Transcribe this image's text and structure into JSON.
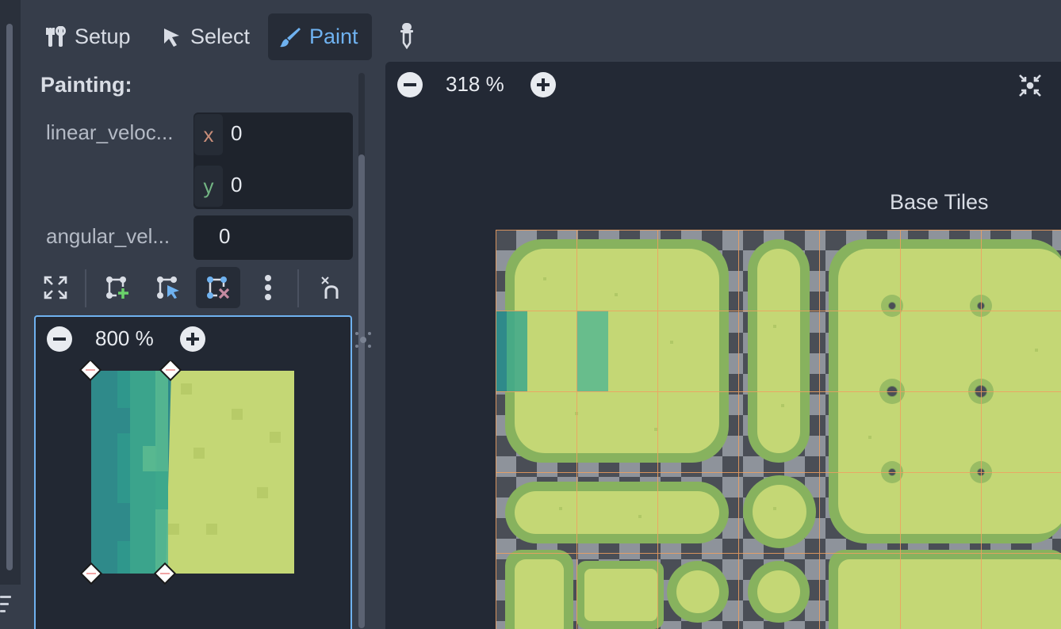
{
  "toolbar": {
    "setup_label": "Setup",
    "select_label": "Select",
    "paint_label": "Paint",
    "active_tab": "Paint",
    "picker_icon": "eyedropper-icon"
  },
  "painting": {
    "heading": "Painting:",
    "linear_velocity": {
      "label": "linear_veloc...",
      "x_tag": "x",
      "x_value": "0",
      "y_tag": "y",
      "y_value": "0"
    },
    "angular_velocity": {
      "label": "angular_vel...",
      "value": "0"
    }
  },
  "polygon_tools": {
    "icons": [
      "expand-icon",
      "add-point-icon",
      "edit-point-icon",
      "remove-point-icon",
      "more-options-icon",
      "snap-icon"
    ],
    "active": "remove-point-icon"
  },
  "tile_preview": {
    "zoom_label": "800 %"
  },
  "atlas": {
    "zoom_label": "318 %",
    "source_title": "Base Tiles"
  },
  "colors": {
    "accent": "#6fb2f0",
    "panel_bg": "#363d4a",
    "field_bg": "#1e232c",
    "grass": "#c4d775",
    "grass_dark": "#87b25e",
    "teal": "#2f8a8a",
    "x_axis": "#c98e7a",
    "y_axis": "#72b583",
    "grid_line": "#f0a060"
  }
}
